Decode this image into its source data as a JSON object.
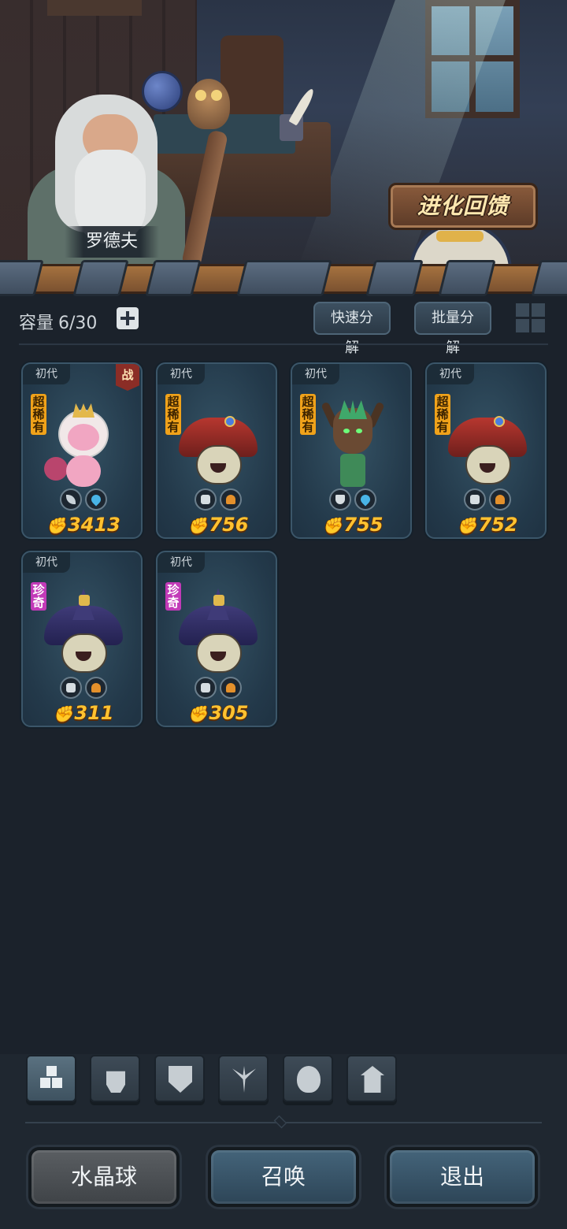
{
  "scene": {
    "npc_name": "罗德夫",
    "evolve_feedback_label": "进化回馈"
  },
  "inventory": {
    "capacity_label": "容量",
    "capacity_value": "6/30",
    "quick_decompose_label": "快速分解",
    "batch_decompose_label": "批量分解"
  },
  "cards": [
    {
      "generation": "初代",
      "rarity": "超稀有",
      "rarity_type": "super",
      "battle_badge": "战",
      "elements": [
        "leaf-icon",
        "water-icon"
      ],
      "power": "3413",
      "creature": "fairy"
    },
    {
      "generation": "初代",
      "rarity": "超稀有",
      "rarity_type": "super",
      "battle_badge": null,
      "elements": [
        "fist-icon",
        "earth-icon"
      ],
      "power": "756",
      "creature": "red-mushroom"
    },
    {
      "generation": "初代",
      "rarity": "超稀有",
      "rarity_type": "super",
      "battle_badge": null,
      "elements": [
        "shield-icon",
        "water-icon"
      ],
      "power": "755",
      "creature": "tree-spirit"
    },
    {
      "generation": "初代",
      "rarity": "超稀有",
      "rarity_type": "super",
      "battle_badge": null,
      "elements": [
        "fist-icon",
        "earth-icon"
      ],
      "power": "752",
      "creature": "red-mushroom"
    },
    {
      "generation": "初代",
      "rarity": "珍奇",
      "rarity_type": "rare",
      "battle_badge": null,
      "elements": [
        "fist-icon",
        "earth-icon"
      ],
      "power": "311",
      "creature": "purple-mushroom"
    },
    {
      "generation": "初代",
      "rarity": "珍奇",
      "rarity_type": "rare",
      "battle_badge": null,
      "elements": [
        "fist-icon",
        "earth-icon"
      ],
      "power": "305",
      "creature": "purple-mushroom"
    }
  ],
  "filter_tabs": [
    {
      "icon": "all-icon",
      "active": true
    },
    {
      "icon": "fist-icon",
      "active": false
    },
    {
      "icon": "shield-icon",
      "active": false
    },
    {
      "icon": "leaf-icon",
      "active": false
    },
    {
      "icon": "alien-icon",
      "active": false
    },
    {
      "icon": "tower-icon",
      "active": false
    }
  ],
  "bottom_buttons": {
    "crystal_ball": "水晶球",
    "summon": "召唤",
    "exit": "退出"
  },
  "colors": {
    "power_text": "#ffc230",
    "super_rare_tag": "#f0a21a",
    "rare_tag": "#c23ab8",
    "background": "#1b222b"
  }
}
